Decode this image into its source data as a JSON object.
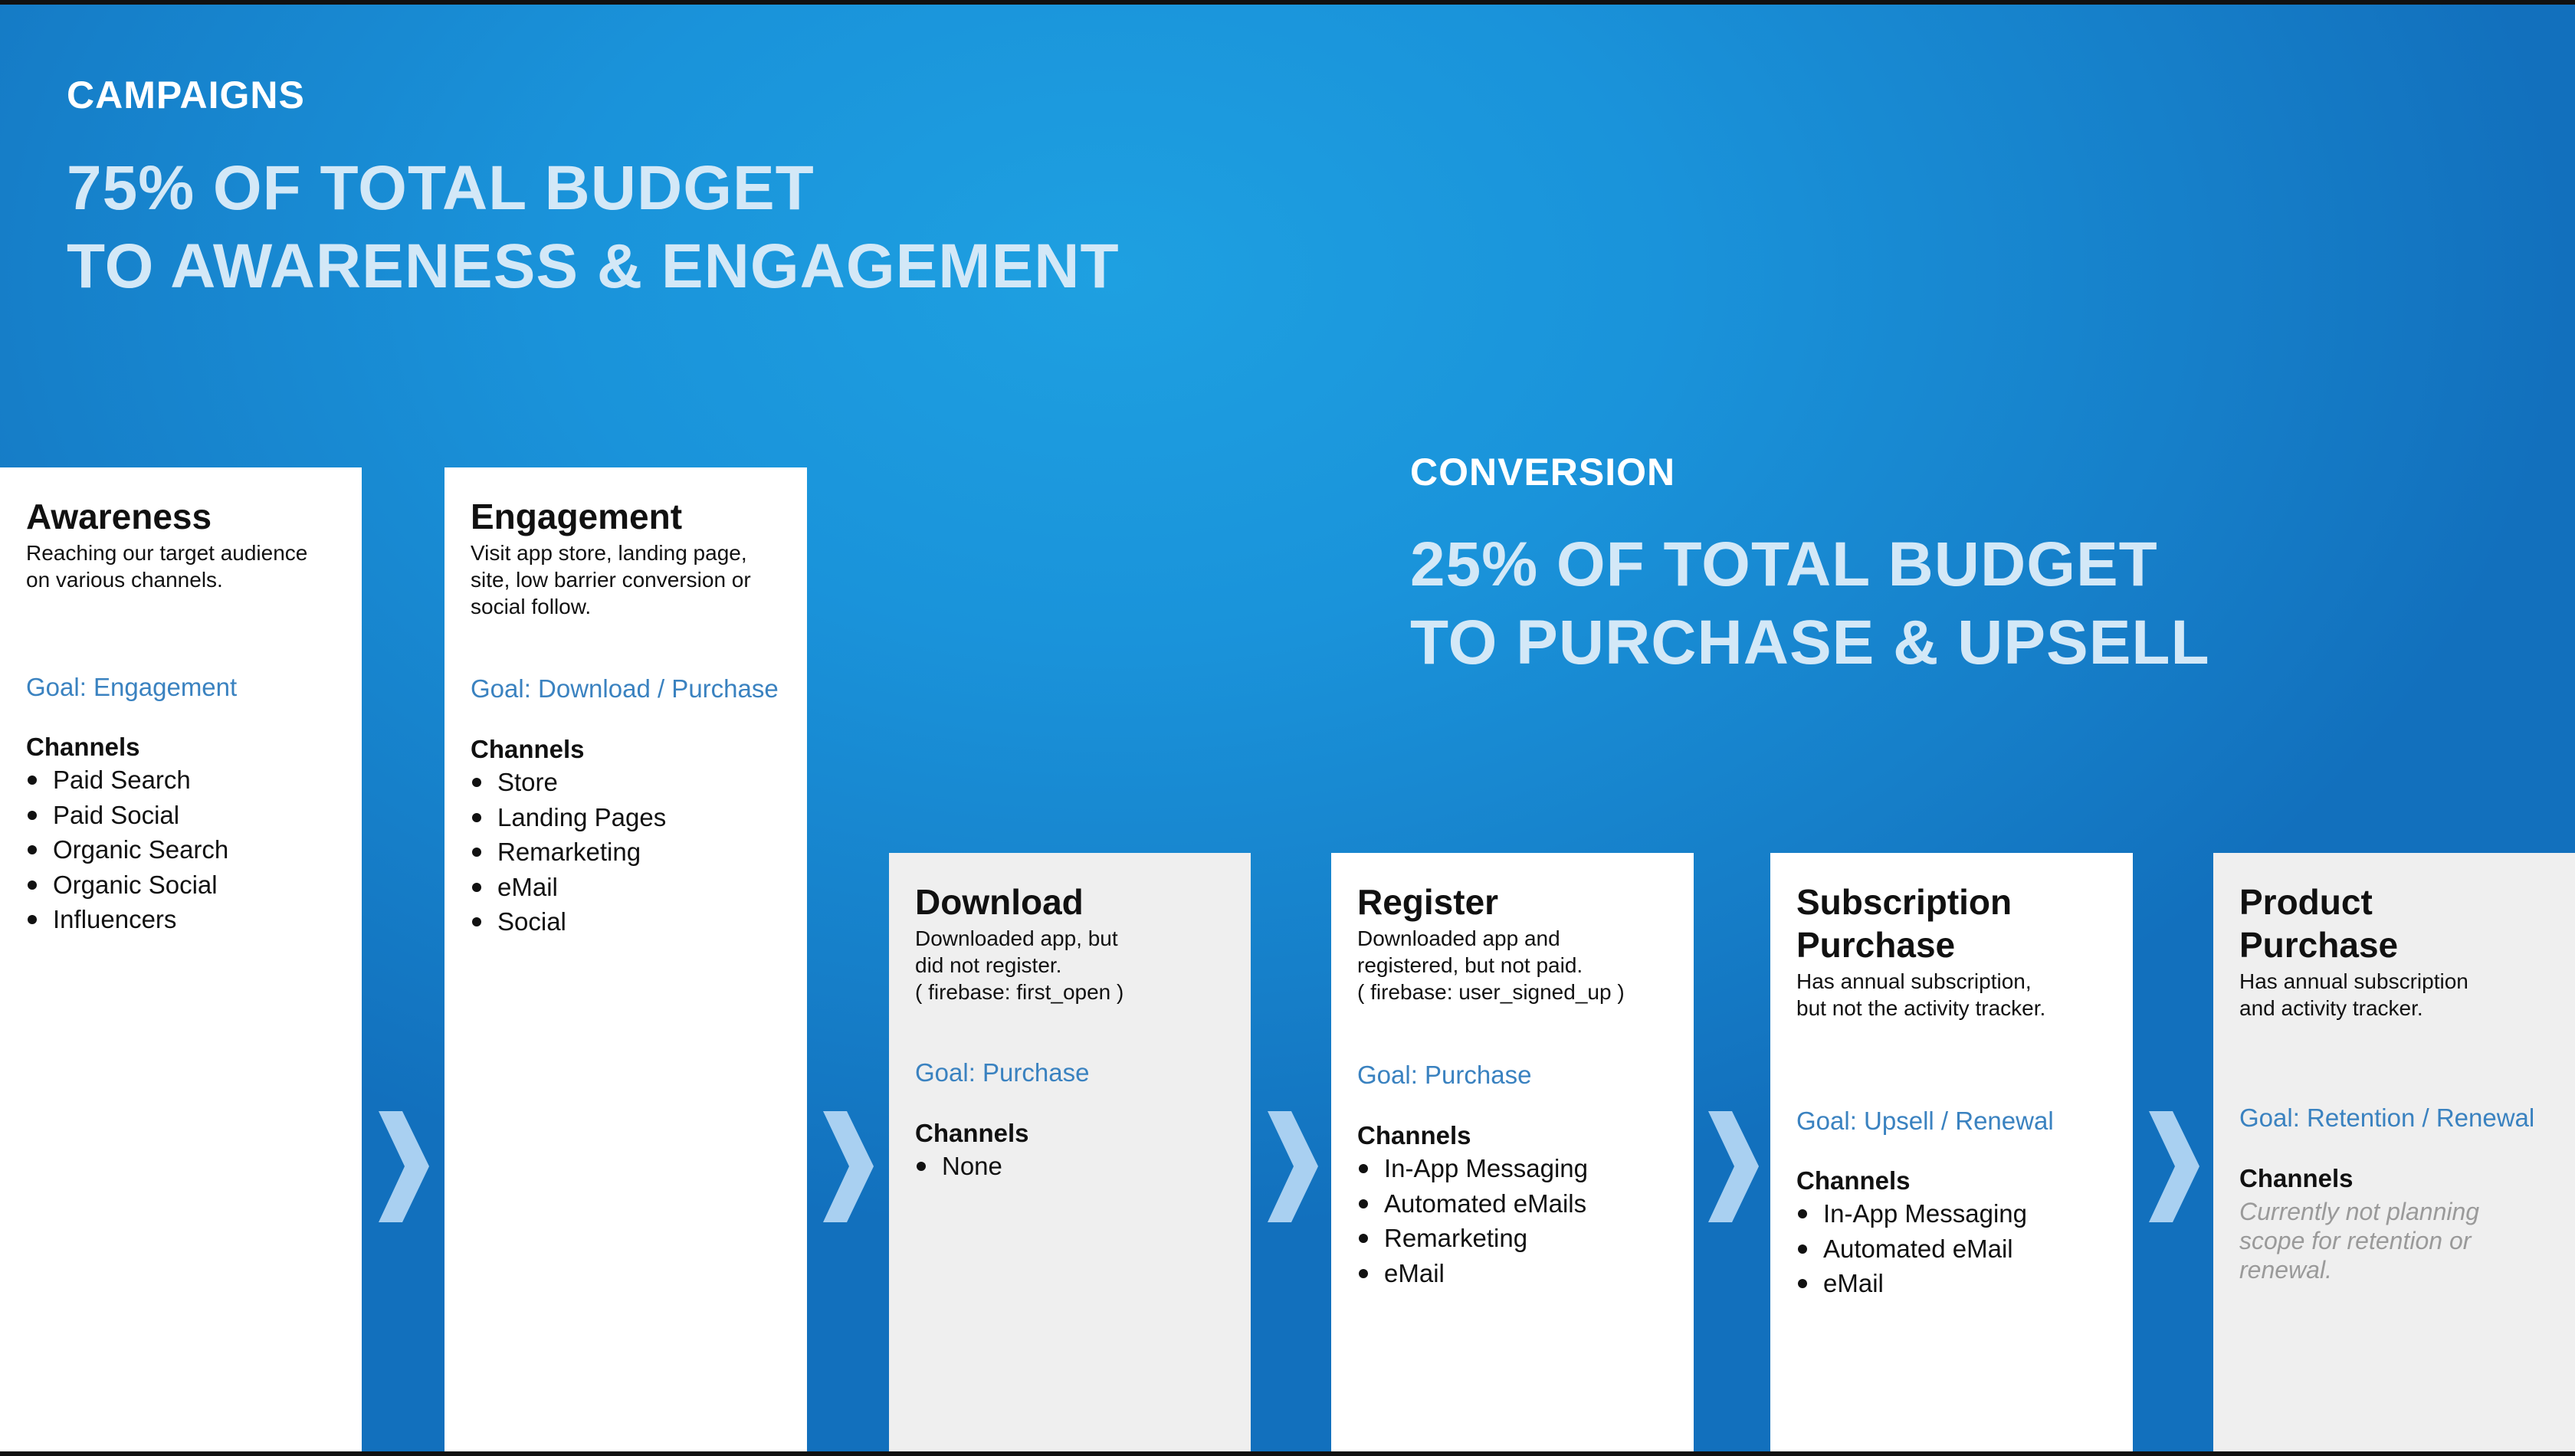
{
  "campaigns": {
    "label": "CAMPAIGNS",
    "headline": [
      "75% OF TOTAL BUDGET",
      "TO AWARENESS & ENGAGEMENT"
    ]
  },
  "conversion": {
    "label": "CONVERSION",
    "headline": [
      "25% OF TOTAL BUDGET",
      "TO PURCHASE & UPSELL"
    ]
  },
  "colors": {
    "background": "#1a93da",
    "headline": "#d3e8f7",
    "goal": "#3a82c0",
    "card_light": "#ffffff",
    "card_gray": "#efefef",
    "chevron": "#a9d0f1",
    "note": "#9a9a9a"
  },
  "connector_icon": "chevron-right-icon",
  "cards": [
    {
      "title": [
        "Awareness"
      ],
      "description": [
        "Reaching our target audience",
        "on various channels."
      ],
      "goal": "Goal: Engagement",
      "channels_heading": "Channels",
      "channels": [
        "Paid Search",
        "Paid Social",
        "Organic Search",
        "Organic Social",
        "Influencers"
      ]
    },
    {
      "title": [
        "Engagement"
      ],
      "description": [
        "Visit app store, landing page,",
        "site, low barrier conversion or",
        "social follow."
      ],
      "goal": "Goal: Download / Purchase",
      "channels_heading": "Channels",
      "channels": [
        "Store",
        "Landing Pages",
        "Remarketing",
        "eMail",
        "Social"
      ]
    },
    {
      "title": [
        "Download"
      ],
      "description": [
        "Downloaded app, but",
        "did not register.",
        "( firebase: first_open )"
      ],
      "goal": "Goal: Purchase",
      "channels_heading": "Channels",
      "channels": [
        "None"
      ]
    },
    {
      "title": [
        "Register"
      ],
      "description": [
        "Downloaded app and",
        "registered, but not paid.",
        "( firebase: user_signed_up )"
      ],
      "goal": "Goal: Purchase",
      "channels_heading": "Channels",
      "channels": [
        "In-App Messaging",
        "Automated eMails",
        "Remarketing",
        "eMail"
      ]
    },
    {
      "title": [
        "Subscription",
        "Purchase"
      ],
      "description": [
        "Has annual subscription,",
        "but not the activity tracker."
      ],
      "goal": "Goal: Upsell / Renewal",
      "channels_heading": "Channels",
      "channels": [
        "In-App Messaging",
        "Automated eMail",
        "eMail"
      ]
    },
    {
      "title": [
        "Product",
        "Purchase"
      ],
      "description": [
        "Has annual subscription",
        "and activity tracker."
      ],
      "goal": "Goal: Retention / Renewal",
      "channels_heading": "Channels",
      "channels": [],
      "note": [
        "Currently not planning",
        "scope for retention or",
        "renewal."
      ]
    }
  ]
}
